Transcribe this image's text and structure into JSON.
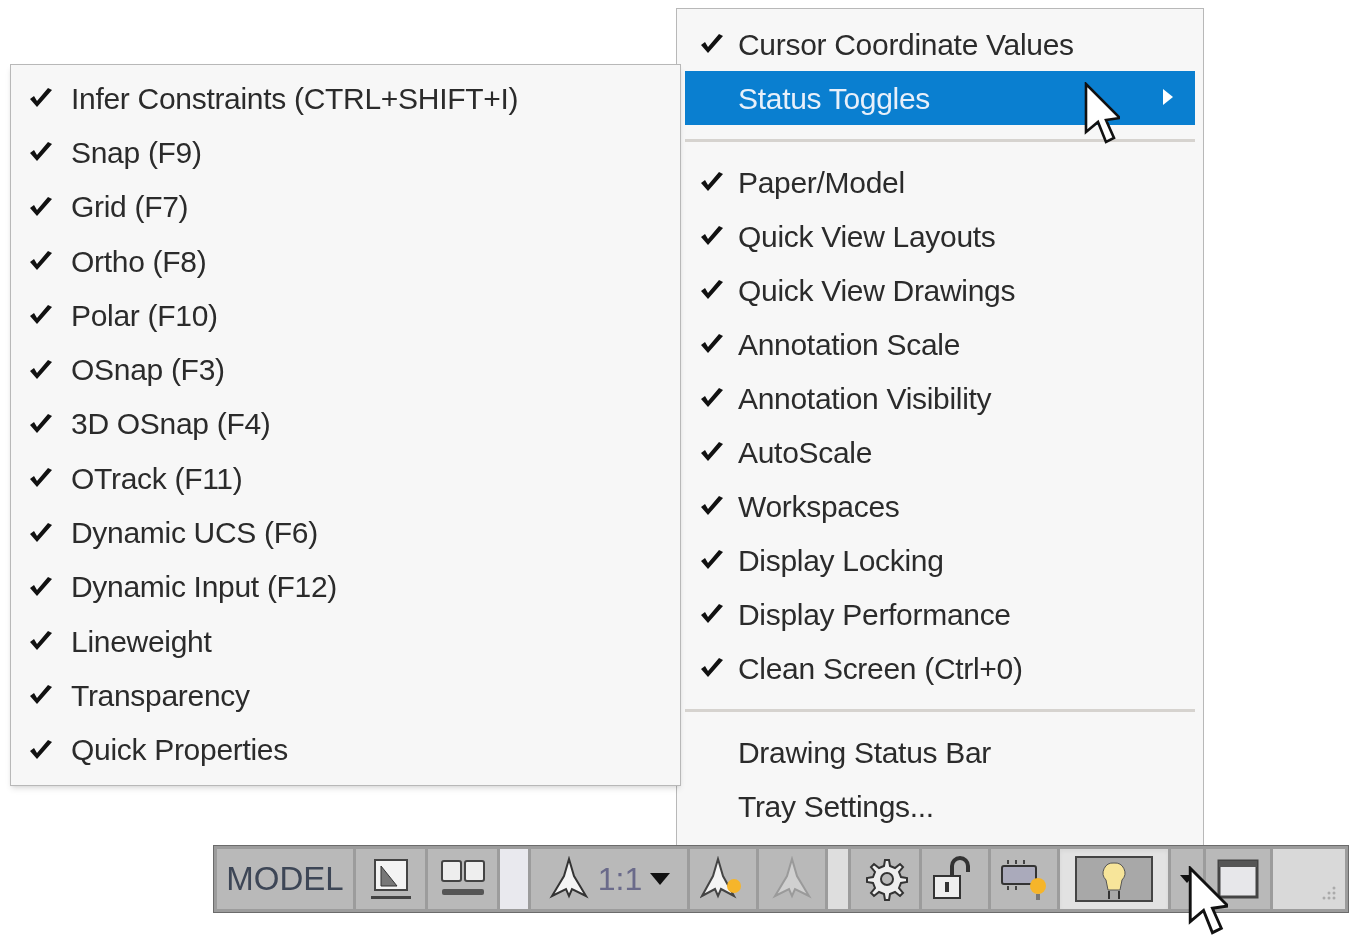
{
  "main_menu": {
    "items": [
      {
        "kind": "item",
        "label": "Cursor Coordinate Values",
        "checked": true,
        "selected": false
      },
      {
        "kind": "submenu",
        "label": "Status Toggles",
        "checked": false,
        "selected": true
      },
      {
        "kind": "separator"
      },
      {
        "kind": "item",
        "label": "Paper/Model",
        "checked": true,
        "selected": false
      },
      {
        "kind": "item",
        "label": "Quick View Layouts",
        "checked": true,
        "selected": false
      },
      {
        "kind": "item",
        "label": "Quick View Drawings",
        "checked": true,
        "selected": false
      },
      {
        "kind": "item",
        "label": "Annotation Scale",
        "checked": true,
        "selected": false
      },
      {
        "kind": "item",
        "label": "Annotation Visibility",
        "checked": true,
        "selected": false
      },
      {
        "kind": "item",
        "label": "AutoScale",
        "checked": true,
        "selected": false
      },
      {
        "kind": "item",
        "label": "Workspaces",
        "checked": true,
        "selected": false
      },
      {
        "kind": "item",
        "label": "Display Locking",
        "checked": true,
        "selected": false
      },
      {
        "kind": "item",
        "label": "Display Performance",
        "checked": true,
        "selected": false
      },
      {
        "kind": "item",
        "label": "Clean Screen (Ctrl+0)",
        "checked": true,
        "selected": false
      },
      {
        "kind": "separator"
      },
      {
        "kind": "item",
        "label": "Drawing Status Bar",
        "checked": false,
        "selected": false
      },
      {
        "kind": "item",
        "label": "Tray Settings...",
        "checked": false,
        "selected": false
      }
    ]
  },
  "submenu": {
    "items": [
      {
        "label": "Infer Constraints (CTRL+SHIFT+I)",
        "checked": true
      },
      {
        "label": "Snap (F9)",
        "checked": true
      },
      {
        "label": "Grid (F7)",
        "checked": true
      },
      {
        "label": "Ortho (F8)",
        "checked": true
      },
      {
        "label": "Polar (F10)",
        "checked": true
      },
      {
        "label": "OSnap (F3)",
        "checked": true
      },
      {
        "label": "3D OSnap (F4)",
        "checked": true
      },
      {
        "label": "OTrack (F11)",
        "checked": true
      },
      {
        "label": "Dynamic UCS (F6)",
        "checked": true
      },
      {
        "label": "Dynamic Input (F12)",
        "checked": true
      },
      {
        "label": "Lineweight",
        "checked": true
      },
      {
        "label": "Transparency",
        "checked": true
      },
      {
        "label": "Quick Properties",
        "checked": true
      }
    ]
  },
  "status_bar": {
    "model_label": "MODEL",
    "scale_label": "1:1",
    "lightbulb_button": {
      "pressed": true
    }
  }
}
